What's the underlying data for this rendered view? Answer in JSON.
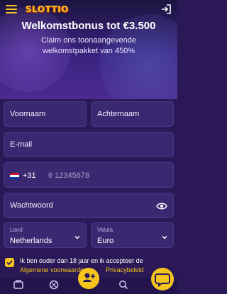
{
  "header": {
    "logo_text": "SLOTTIO",
    "menu_icon": "hamburger-icon",
    "login_icon": "login-arrow-icon"
  },
  "hero": {
    "title": "Welkomstbonus tot €3.500",
    "subtitle": "Claim ons toonaangevende welkomstpakket van 450%"
  },
  "form": {
    "first_name_placeholder": "Voornaam",
    "last_name_placeholder": "Achternaam",
    "email_placeholder": "E-mail",
    "phone": {
      "country_flag": "netherlands-flag",
      "prefix": "+31",
      "placeholder": "6 12345678"
    },
    "password_placeholder": "Wachtwoord",
    "country": {
      "label": "Land",
      "value": "Netherlands"
    },
    "currency": {
      "label": "Valuta",
      "value": "Euro"
    },
    "consent": {
      "text": "Ik ben ouder dan 18 jaar en ik accepteer de",
      "terms_link": "Algemene voorwaarde",
      "privacy_link": "Privacybeleid",
      "checked": true
    }
  },
  "bottom_nav": {
    "items": [
      "casino-icon",
      "sports-icon",
      "register-icon",
      "search-icon",
      "chat-icon"
    ]
  },
  "colors": {
    "background": "#2a1956",
    "field": "#3a2870",
    "accent": "#f6c51c"
  }
}
